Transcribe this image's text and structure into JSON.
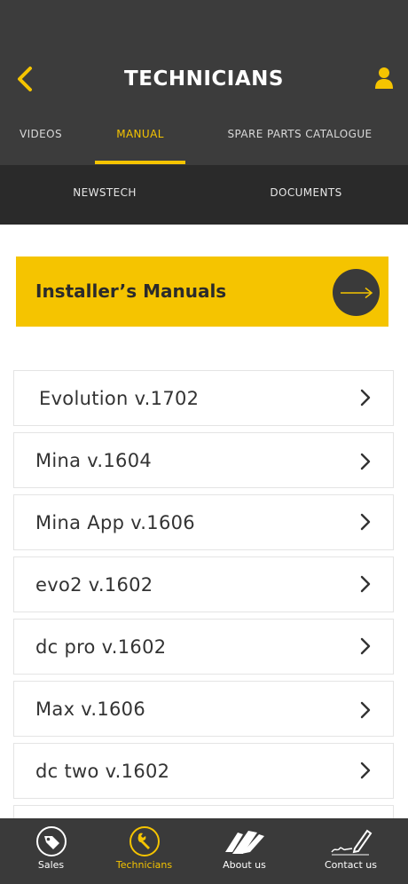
{
  "header": {
    "title": "TECHNICIANS",
    "back_icon": "chevron-left-icon",
    "profile_icon": "user-icon"
  },
  "tabs": [
    {
      "label": "VIDEOS",
      "active": false
    },
    {
      "label": "MANUAL",
      "active": true
    },
    {
      "label": "SPARE PARTS CATALOGUE",
      "active": false
    }
  ],
  "subtabs": [
    {
      "label": "NEWSTECH"
    },
    {
      "label": "DOCUMENTS"
    }
  ],
  "banner": {
    "title": "Installer’s Manuals",
    "icon": "arrow-right-icon"
  },
  "manuals": [
    {
      "label": "Evolution v.1702"
    },
    {
      "label": "Mina v.1604"
    },
    {
      "label": "Mina App v.1606"
    },
    {
      "label": "evo2 v.1602"
    },
    {
      "label": "dc pro v.1602"
    },
    {
      "label": "Max v.1606"
    },
    {
      "label": "dc two v.1602"
    }
  ],
  "bottom_nav": [
    {
      "label": "Sales",
      "icon": "tag-icon",
      "active": false
    },
    {
      "label": "Technicians",
      "icon": "wrench-icon",
      "active": true
    },
    {
      "label": "About us",
      "icon": "brush-stroke-icon",
      "active": false
    },
    {
      "label": "Contact us",
      "icon": "pen-signature-icon",
      "active": false
    }
  ],
  "colors": {
    "accent": "#f5c400",
    "header_bg": "#3c3c3c",
    "subnav_bg": "#2a2a2a",
    "bottom_nav_bg": "#3a3a3a"
  }
}
